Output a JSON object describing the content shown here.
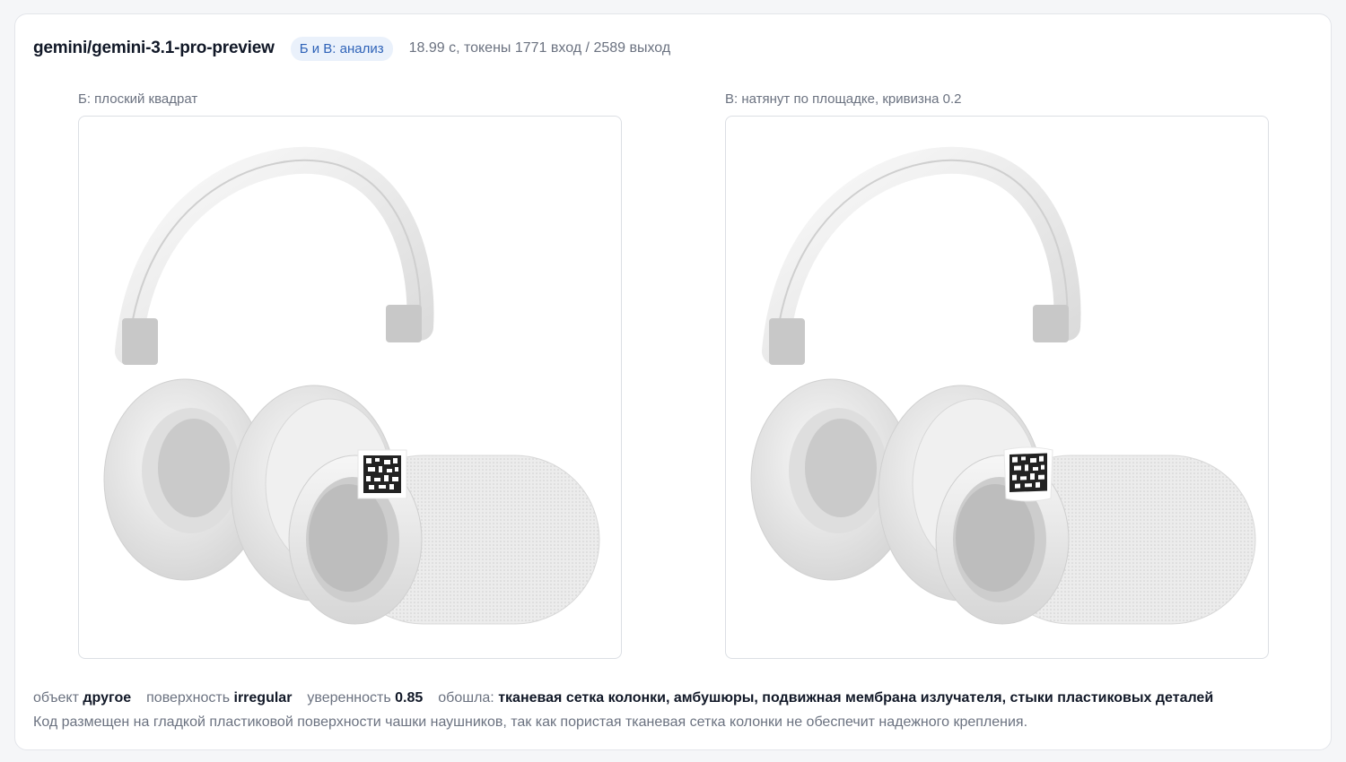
{
  "header": {
    "model": "gemini/gemini-3.1-pro-preview",
    "badge": "Б и В: анализ",
    "meta": "18.99 с, токены 1771 вход / 2589 выход"
  },
  "panels": [
    {
      "label": "Б: плоский квадрат",
      "image": "headphones-speaker-flat-code"
    },
    {
      "label": "В: натянут по площадке, кривизна 0.2",
      "image": "headphones-speaker-curved-code"
    }
  ],
  "summary": {
    "object_label": "объект",
    "object_value": "другое",
    "surface_label": "поверхность",
    "surface_value": "irregular",
    "confidence_label": "уверенность",
    "confidence_value": "0.85",
    "avoided_label": "обошла:",
    "avoided_value": "тканевая сетка колонки, амбушюры, подвижная мембрана излучателя, стыки пластиковых деталей"
  },
  "note": "Код размещен на гладкой пластиковой поверхности чашки наушников, так как пористая тканевая сетка колонки не обеспечит надежного крепления."
}
